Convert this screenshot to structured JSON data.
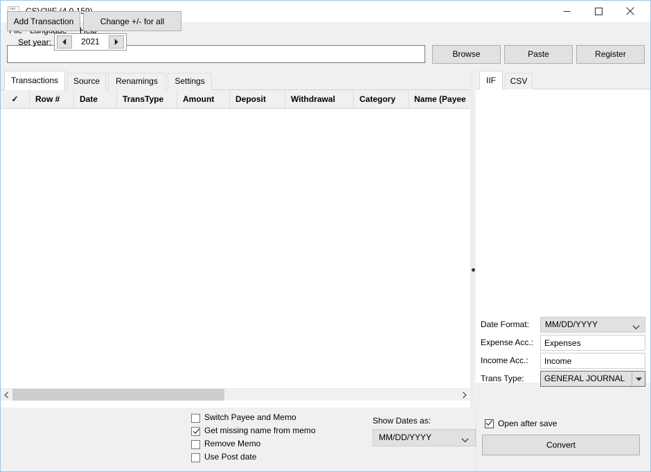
{
  "window": {
    "title": "CSV2IIF (4.0.159)",
    "icon": "app-document-icon",
    "controls": {
      "minimize": "minimize-icon",
      "maximize": "maximize-icon",
      "close": "close-icon"
    }
  },
  "menubar": {
    "items": [
      {
        "label": "File"
      },
      {
        "label": "Language"
      },
      {
        "label": "Help"
      }
    ]
  },
  "toolbar": {
    "path_value": "",
    "path_placeholder": "",
    "browse_label": "Browse",
    "paste_label": "Paste",
    "register_label": "Register"
  },
  "left_panel": {
    "tabs": [
      {
        "label": "Transactions",
        "active": true
      },
      {
        "label": "Source",
        "active": false
      },
      {
        "label": "Renamings",
        "active": false
      },
      {
        "label": "Settings",
        "active": false
      }
    ],
    "grid": {
      "columns": [
        {
          "label": "✓"
        },
        {
          "label": "Row #"
        },
        {
          "label": "Date"
        },
        {
          "label": "TransType"
        },
        {
          "label": "Amount"
        },
        {
          "label": "Deposit"
        },
        {
          "label": "Withdrawal"
        },
        {
          "label": "Category"
        },
        {
          "label": "Name (Payee"
        }
      ],
      "rows": []
    }
  },
  "right_panel": {
    "tabs": [
      {
        "label": "IIF",
        "active": true
      },
      {
        "label": "CSV",
        "active": false
      }
    ],
    "preview_text": "",
    "fields": {
      "date_format_label": "Date Format:",
      "date_format_value": "MM/DD/YYYY",
      "expense_acc_label": "Expense Acc.:",
      "expense_acc_value": "Expenses",
      "income_acc_label": "Income Acc.:",
      "income_acc_value": "Income",
      "trans_type_label": "Trans Type:",
      "trans_type_value": "GENERAL JOURNAL"
    },
    "open_after_save_label": "Open after save",
    "open_after_save_checked": true,
    "convert_label": "Convert"
  },
  "bottom": {
    "add_transaction_label": "Add Transaction",
    "change_sign_label": "Change +/- for all",
    "set_year_label": "Set year:",
    "set_year_value": "2021",
    "checkboxes": [
      {
        "label": "Switch Payee and Memo",
        "checked": false
      },
      {
        "label": "Get missing name from memo",
        "checked": true
      },
      {
        "label": "Remove Memo",
        "checked": false
      },
      {
        "label": "Use Post date",
        "checked": false
      }
    ],
    "show_dates_label": "Show Dates as:",
    "show_dates_value": "MM/DD/YYYY"
  },
  "colors": {
    "window_border": "#9cc3e5",
    "face": "#f0f0f0",
    "button_face": "#e1e1e1",
    "field": "#ffffff"
  }
}
